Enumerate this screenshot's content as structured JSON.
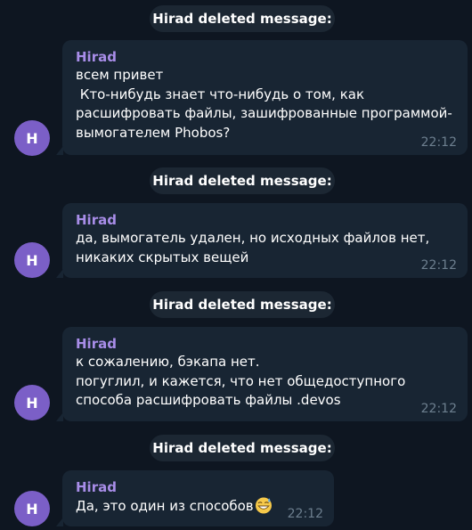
{
  "chat": {
    "service_messages": [
      "Hirad deleted message:",
      "Hirad deleted message:",
      "Hirad deleted message:",
      "Hirad deleted message:"
    ],
    "messages": [
      {
        "avatar_initial": "H",
        "sender": "Hirad",
        "text": "всем привет\n Кто-нибудь знает что-нибудь о том, как расшифровать файлы, зашифрованные программой-вымогателем Phobos?",
        "time": "22:12"
      },
      {
        "avatar_initial": "H",
        "sender": "Hirad",
        "text": "да, вымогатель удален, но исходных файлов нет, никаких скрытых вещей",
        "time": "22:12"
      },
      {
        "avatar_initial": "H",
        "sender": "Hirad",
        "text": "к сожалению, бэкапа нет.\nпогуглил, и кажется, что нет общедоступного способа расшифровать файлы .devos",
        "time": "22:12"
      },
      {
        "avatar_initial": "H",
        "sender": "Hirad",
        "text": "Да, это один из способов",
        "emoji": "grinning-sweat-emoji",
        "time": "22:12"
      }
    ]
  },
  "colors": {
    "background": "#0e1621",
    "bubble": "#182533",
    "service_pill": "#1c2733",
    "sender_name": "#a88de8",
    "avatar": "#7b5fc7",
    "timestamp": "#6d7f8f"
  }
}
